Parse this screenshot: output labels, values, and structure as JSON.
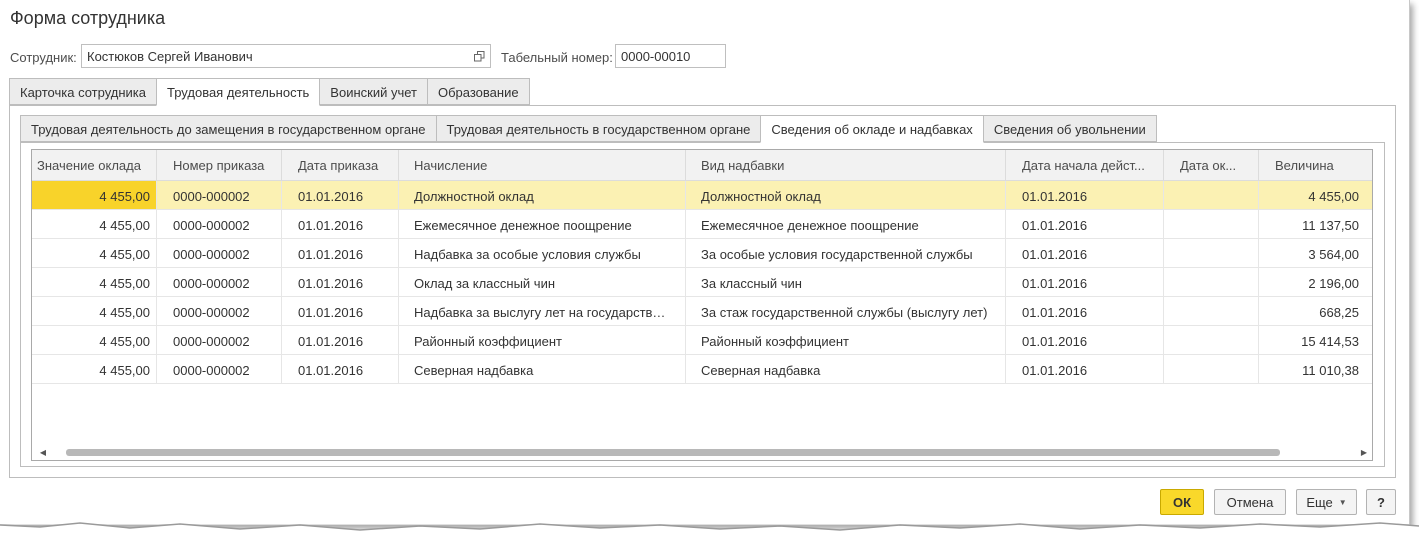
{
  "window": {
    "title": "Форма сотрудника"
  },
  "employee": {
    "label": "Сотрудник:",
    "value": "Костюков Сергей Иванович",
    "tab_number_label": "Табельный номер:",
    "tab_number_value": "0000-00010"
  },
  "main_tabs": [
    {
      "label": "Карточка сотрудника",
      "active": false
    },
    {
      "label": "Трудовая деятельность",
      "active": true
    },
    {
      "label": "Воинский учет",
      "active": false
    },
    {
      "label": "Образование",
      "active": false
    }
  ],
  "sub_tabs": [
    {
      "label": "Трудовая деятельность до замещения в государственном органе",
      "active": false
    },
    {
      "label": "Трудовая деятельность в государственном органе",
      "active": false
    },
    {
      "label": "Сведения об окладе и надбавках",
      "active": true
    },
    {
      "label": "Сведения об увольнении",
      "active": false
    }
  ],
  "table": {
    "columns": [
      "Значение оклада",
      "Номер приказа",
      "Дата приказа",
      "Начисление",
      "Вид надбавки",
      "Дата начала дейст...",
      "Дата ок...",
      "Величина"
    ],
    "rows": [
      [
        "4 455,00",
        "0000-000002",
        "01.01.2016",
        "Должностной оклад",
        "Должностной оклад",
        "01.01.2016",
        "",
        "4 455,00"
      ],
      [
        "4 455,00",
        "0000-000002",
        "01.01.2016",
        "Ежемесячное денежное поощрение",
        "Ежемесячное денежное поощрение",
        "01.01.2016",
        "",
        "11 137,50"
      ],
      [
        "4 455,00",
        "0000-000002",
        "01.01.2016",
        "Надбавка за особые условия службы",
        "За особые условия государственной службы",
        "01.01.2016",
        "",
        "3 564,00"
      ],
      [
        "4 455,00",
        "0000-000002",
        "01.01.2016",
        "Оклад за классный чин",
        "За классный чин",
        "01.01.2016",
        "",
        "2 196,00"
      ],
      [
        "4 455,00",
        "0000-000002",
        "01.01.2016",
        "Надбавка за выслугу лет на государств…",
        "За стаж государственной службы (выслугу лет)",
        "01.01.2016",
        "",
        "668,25"
      ],
      [
        "4 455,00",
        "0000-000002",
        "01.01.2016",
        "Районный коэффициент",
        "Районный коэффициент",
        "01.01.2016",
        "",
        "15 414,53"
      ],
      [
        "4 455,00",
        "0000-000002",
        "01.01.2016",
        "Северная надбавка",
        "Северная надбавка",
        "01.01.2016",
        "",
        "11 010,38"
      ]
    ],
    "selected_row": 0
  },
  "buttons": {
    "ok": "ОК",
    "cancel": "Отмена",
    "more": "Еще",
    "help": "?"
  },
  "colors": {
    "accent": "#f9d82a",
    "selected_row": "#fbf1b3",
    "current_cell": "#f8d32a"
  }
}
